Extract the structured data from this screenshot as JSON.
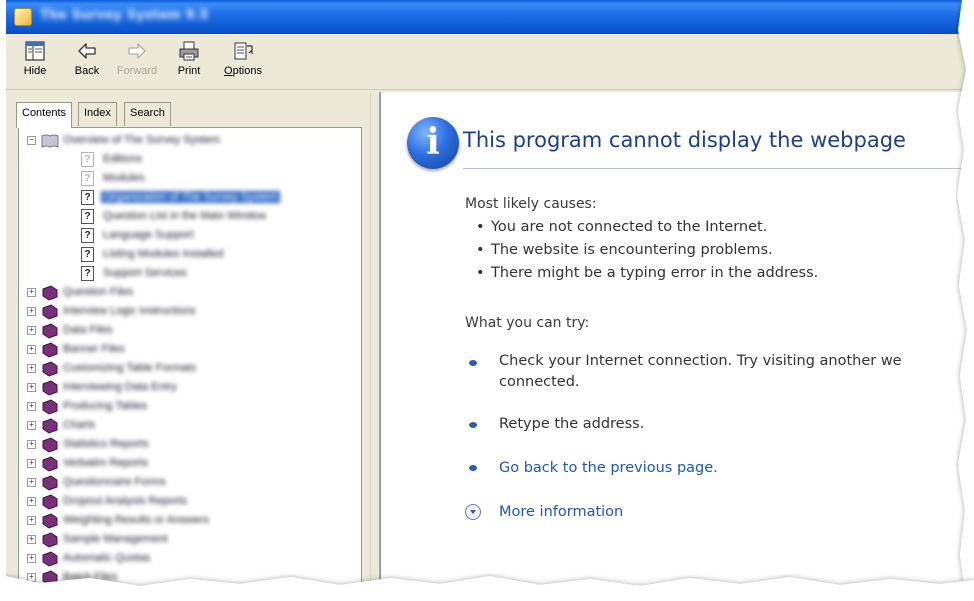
{
  "window": {
    "title": "The Survey System 9.5",
    "colors": {
      "titlebar": "#0e58d0",
      "selection": "#316ac5",
      "heading": "#1b3f8e",
      "link": "#1e56b8"
    }
  },
  "toolbar": {
    "buttons": [
      {
        "label": "Hide",
        "icon": "hide-icon",
        "enabled": true
      },
      {
        "label": "Back",
        "icon": "back-arrow-icon",
        "enabled": true
      },
      {
        "label": "Forward",
        "icon": "forward-arrow-icon",
        "enabled": false
      },
      {
        "label": "Print",
        "icon": "printer-icon",
        "enabled": true
      },
      {
        "label": "Options",
        "icon": "options-icon",
        "enabled": true
      }
    ]
  },
  "nav": {
    "tabs": [
      {
        "label": "Contents",
        "active": true
      },
      {
        "label": "Index",
        "active": false
      },
      {
        "label": "Search",
        "active": false
      }
    ],
    "tree": {
      "root": {
        "label": "Overview of The Survey System",
        "expanded": true
      },
      "children": [
        {
          "label": "Editions",
          "selected": false
        },
        {
          "label": "Modules",
          "selected": false
        },
        {
          "label": "Organization of The Survey System",
          "selected": true
        },
        {
          "label": "Question List in the Main Window",
          "selected": false
        },
        {
          "label": "Language Support",
          "selected": false
        },
        {
          "label": "Listing Modules Installed",
          "selected": false
        },
        {
          "label": "Support Services",
          "selected": false
        }
      ],
      "books": [
        "Question Files",
        "Interview Logic Instructions",
        "Data Files",
        "Banner Files",
        "Customizing Table Formats",
        "Interviewing Data Entry",
        "Producing Tables",
        "Charts",
        "Statistics Reports",
        "Verbatim Reports",
        "Questionnaire Forms",
        "Dropout Analysis Reports",
        "Weighting Results or Answers",
        "Sample Management",
        "Automatic Quotas",
        "Batch Files"
      ]
    }
  },
  "page": {
    "heading": "This program cannot display the webpage",
    "causes_title": "Most likely causes:",
    "causes": [
      "You are not connected to the Internet.",
      "The website is encountering problems.",
      "There might be a typing error in the address."
    ],
    "try_title": "What you can try:",
    "try_items": [
      {
        "line1": "Check your Internet connection. Try visiting another we",
        "line2": "connected.",
        "link": false
      },
      {
        "line1": "Retype the address.",
        "line2": "",
        "link": false
      },
      {
        "line1": "Go back to the previous page.",
        "line2": "",
        "link": true
      }
    ],
    "more_info": "More information"
  }
}
